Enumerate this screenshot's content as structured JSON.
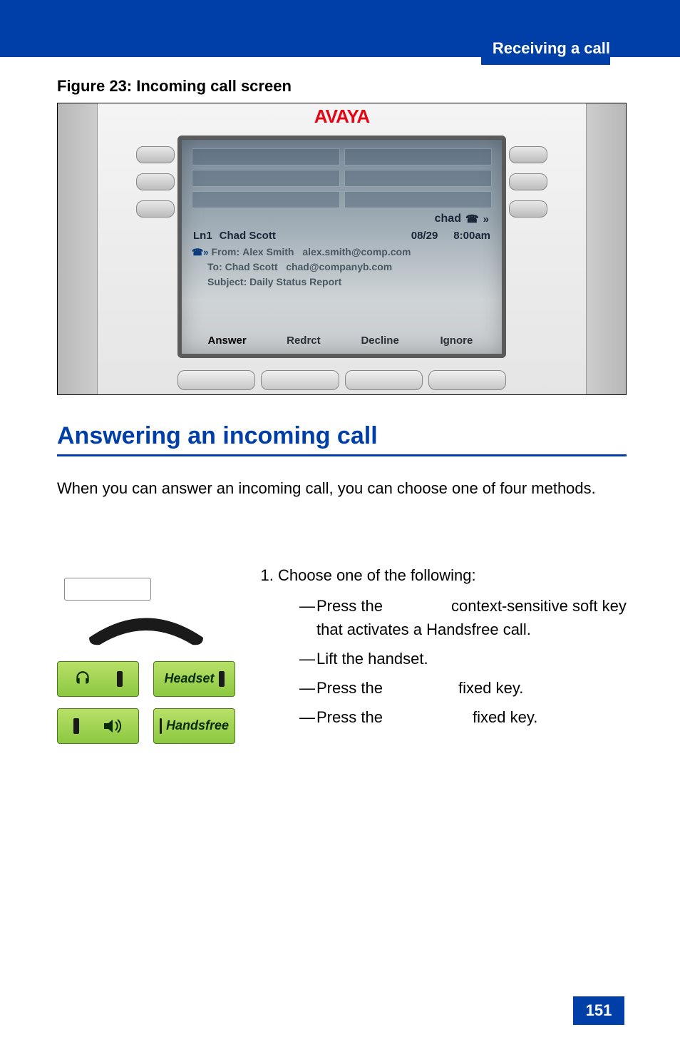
{
  "header": {
    "title": "Receiving a call"
  },
  "figure": {
    "caption": "Figure 23: Incoming call screen"
  },
  "device": {
    "brand": "AVAYA",
    "status_name": "chad",
    "line_label": "Ln1",
    "caller_name": "Chad Scott",
    "date": "08/29",
    "time": "8:00am",
    "from_label": "From:",
    "from_name": "Alex Smith",
    "from_addr": "alex.smith@comp.com",
    "to_label": "To:",
    "to_name": "Chad Scott",
    "to_addr": "chad@companyb.com",
    "subject_label": "Subject:",
    "subject_value": "Daily Status Report",
    "softkeys": [
      "Answer",
      "Redrct",
      "Decline",
      "Ignore"
    ]
  },
  "section": {
    "heading": "Answering an incoming call"
  },
  "body": {
    "intro": "When you can answer an incoming call, you can choose one of four methods."
  },
  "keys": {
    "headset": "Headset",
    "handsfree": "Handsfree"
  },
  "instructions": {
    "lead": "Choose one of the following:",
    "i1a": "Press the ",
    "i1b": "context-sensitive soft key that activates a Handsfree call.",
    "i2": "Lift the handset.",
    "i3a": "Press the ",
    "i3b": "fixed key.",
    "i4a": "Press the ",
    "i4b": "fixed key."
  },
  "page_number": "151"
}
